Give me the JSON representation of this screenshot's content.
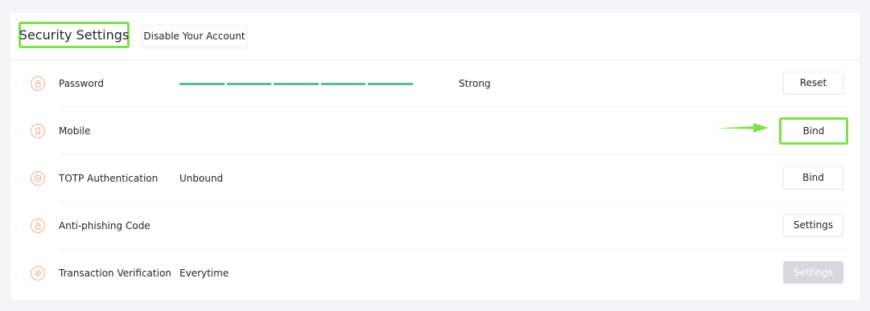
{
  "header": {
    "title": "Security Settings",
    "disable_account_label": "Disable Your Account"
  },
  "rows": [
    {
      "label": "Password",
      "value": "",
      "strength_label": "Strong",
      "strength_fraction": 1.0,
      "button": "Reset",
      "icon": "lock-icon"
    },
    {
      "label": "Mobile",
      "value": "",
      "button": "Bind",
      "icon": "mobile-icon"
    },
    {
      "label": "TOTP Authentication",
      "value": "Unbound",
      "button": "Bind",
      "icon": "shield-icon"
    },
    {
      "label": "Anti-phishing Code",
      "value": "",
      "button": "Settings",
      "icon": "lock-icon"
    },
    {
      "label": "Transaction Verification",
      "value": "Everytime",
      "button": "Settings",
      "icon": "target-icon"
    }
  ],
  "colors": {
    "highlight": "#7ee04a",
    "strength_bar": "#5fba8e",
    "icon_accent": "#eab28a",
    "disabled_button": "#d5d8dc"
  }
}
